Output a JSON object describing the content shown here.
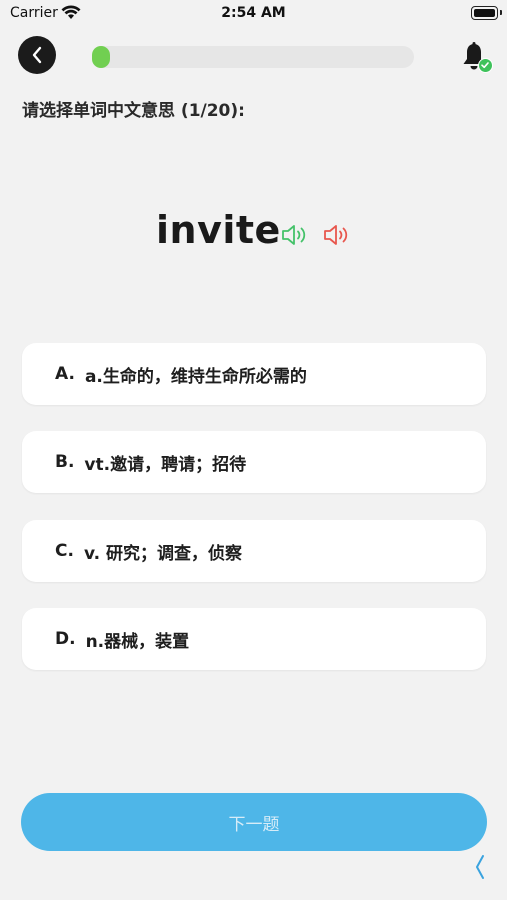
{
  "status_bar": {
    "carrier": "Carrier",
    "time": "2:54 AM",
    "icons": [
      "wifi-icon",
      "battery-icon"
    ]
  },
  "nav": {
    "back_icon": "chevron-left-icon",
    "progress": 0.05,
    "notification_icon": "bell-icon",
    "notification_badge_icon": "checkmark-icon"
  },
  "quiz": {
    "prompt": "请选择单词中文意思 (1/20):",
    "word": "invite",
    "speaker_icons": [
      "speaker-green-icon",
      "speaker-red-icon"
    ],
    "options": [
      {
        "letter": "A.",
        "text": "a.生命的，维持生命所必需的"
      },
      {
        "letter": "B.",
        "text": "vt.邀请，聘请；招待"
      },
      {
        "letter": "C.",
        "text": "v. 研究；调查，侦察"
      },
      {
        "letter": "D.",
        "text": "n.器械，装置"
      }
    ],
    "next_label": "下一题"
  },
  "colors": {
    "background": "#f2f2f2",
    "progress_fill": "#71cf51",
    "next_button": "#4eb6e8",
    "speaker_green": "#45c26a",
    "speaker_red": "#e8574e"
  }
}
